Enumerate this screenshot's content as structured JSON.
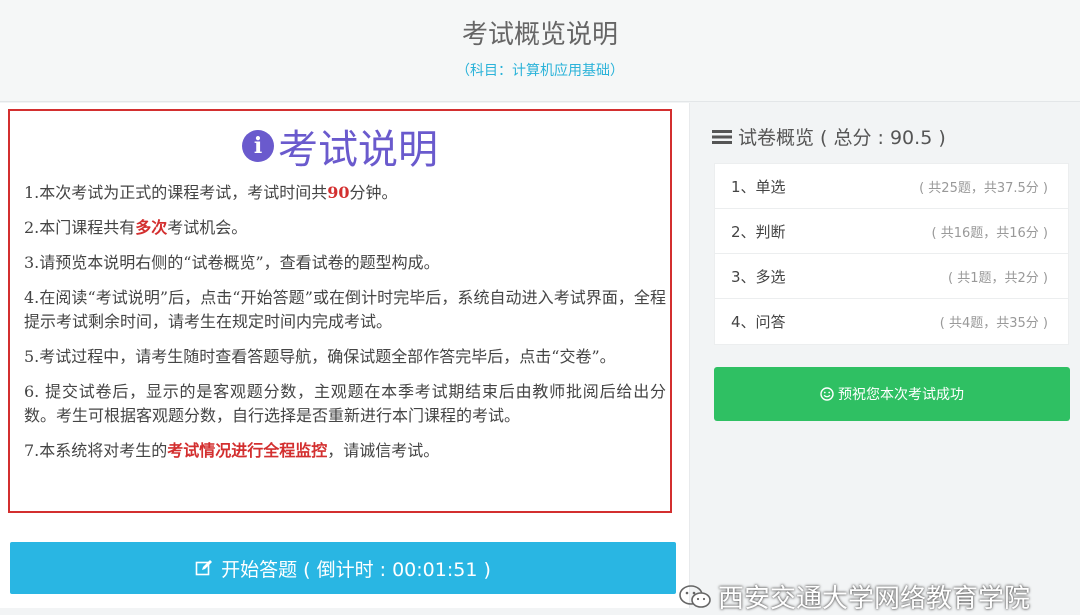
{
  "header": {
    "title": "考试概览说明",
    "subtitle": "（科目：计算机应用基础）"
  },
  "intro": {
    "icon": "info-circle-icon",
    "title": "考试说明",
    "rules": [
      {
        "pre": "1.本次考试为正式的课程考试，考试时间共",
        "hl": "90",
        "post": "分钟。"
      },
      {
        "pre": "2.本门课程共有",
        "hl": "多次",
        "post": "考试机会。"
      },
      {
        "pre": "3.请预览本说明右侧的“试卷概览”，查看试卷的题型构成。",
        "hl": "",
        "post": ""
      },
      {
        "pre": "4.在阅读“考试说明”后，点击“开始答题”或在倒计时完毕后，系统自动进入考试界面，全程提示考试剩余时间，请考生在规定时间内完成考试。",
        "hl": "",
        "post": ""
      },
      {
        "pre": "5.考试过程中，请考生随时查看答题导航，确保试题全部作答完毕后，点击“交卷”。",
        "hl": "",
        "post": ""
      },
      {
        "pre": "6. 提交试卷后，显示的是客观题分数，主观题在本季考试期结束后由教师批阅后给出分数。考生可根据客观题分数，自行选择是否重新进行本门课程的考试。",
        "hl": "",
        "post": ""
      },
      {
        "pre": "7.本系统将对考生的",
        "hl": "考试情况进行全程监控",
        "post": "，请诚信考试。"
      }
    ]
  },
  "start_button": {
    "label": "开始答题 ( 倒计时 : 00:01:51 )",
    "icon": "edit-icon"
  },
  "overview": {
    "title": "试卷概览 ( 总分 : 90.5 )",
    "icon": "list-icon",
    "types": [
      {
        "name": "1、单选",
        "detail": "( 共25题，共37.5分 )"
      },
      {
        "name": "2、判断",
        "detail": "( 共16题，共16分 )"
      },
      {
        "name": "3、多选",
        "detail": "( 共1题，共2分 )"
      },
      {
        "name": "4、问答",
        "detail": "( 共4题，共35分 )"
      }
    ]
  },
  "wish_button": {
    "label": "预祝您本次考试成功",
    "icon": "smile-icon"
  },
  "watermark": {
    "text": "西安交通大学网络教育学院",
    "icon": "wechat-icon"
  },
  "colors": {
    "accent_blue": "#29b6e3",
    "success_green": "#2fc063",
    "highlight_red": "#d32f2f",
    "title_purple": "#6a5acd"
  }
}
